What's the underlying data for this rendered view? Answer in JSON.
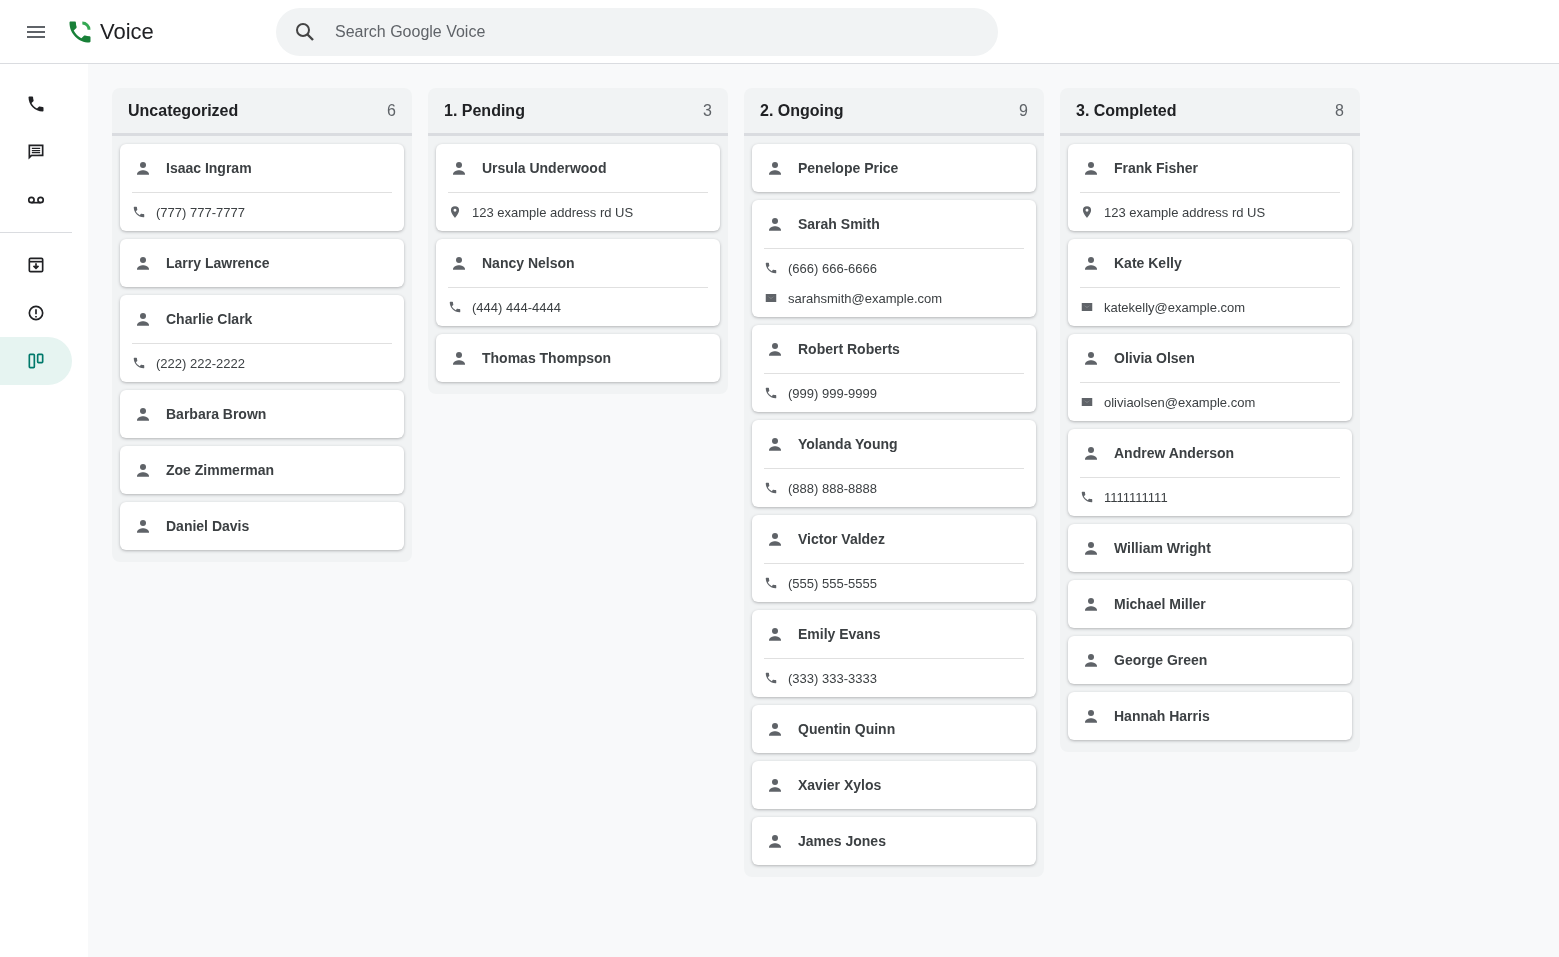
{
  "app": {
    "title": "Voice"
  },
  "search": {
    "placeholder": "Search Google Voice"
  },
  "nav": [
    {
      "kind": "calls",
      "selected": false
    },
    {
      "kind": "messages",
      "selected": false
    },
    {
      "kind": "voicemail",
      "selected": false
    },
    {
      "kind": "archive",
      "selected": false
    },
    {
      "kind": "spam",
      "selected": false
    },
    {
      "kind": "board",
      "selected": true
    }
  ],
  "columns": [
    {
      "title": "Uncategorized",
      "count": "6",
      "cards": [
        {
          "name": "Isaac Ingram",
          "details": [
            {
              "kind": "phone",
              "text": "(777) 777-7777"
            }
          ]
        },
        {
          "name": "Larry Lawrence"
        },
        {
          "name": "Charlie Clark",
          "details": [
            {
              "kind": "phone",
              "text": "(222) 222-2222"
            }
          ]
        },
        {
          "name": "Barbara Brown"
        },
        {
          "name": "Zoe Zimmerman"
        },
        {
          "name": "Daniel Davis"
        }
      ]
    },
    {
      "title": "1. Pending",
      "count": "3",
      "cards": [
        {
          "name": "Ursula Underwood",
          "details": [
            {
              "kind": "address",
              "text": "123 example address rd US"
            }
          ]
        },
        {
          "name": "Nancy Nelson",
          "details": [
            {
              "kind": "phone",
              "text": "(444) 444-4444"
            }
          ]
        },
        {
          "name": "Thomas Thompson"
        }
      ]
    },
    {
      "title": "2. Ongoing",
      "count": "9",
      "cards": [
        {
          "name": "Penelope Price"
        },
        {
          "name": "Sarah Smith",
          "details": [
            {
              "kind": "phone",
              "text": "(666) 666-6666"
            },
            {
              "kind": "email",
              "text": "sarahsmith@example.com"
            }
          ]
        },
        {
          "name": "Robert Roberts",
          "details": [
            {
              "kind": "phone",
              "text": "(999) 999-9999"
            }
          ]
        },
        {
          "name": "Yolanda Young",
          "details": [
            {
              "kind": "phone",
              "text": "(888) 888-8888"
            }
          ]
        },
        {
          "name": "Victor Valdez",
          "details": [
            {
              "kind": "phone",
              "text": "(555) 555-5555"
            }
          ]
        },
        {
          "name": "Emily Evans",
          "details": [
            {
              "kind": "phone",
              "text": "(333) 333-3333"
            }
          ]
        },
        {
          "name": "Quentin Quinn"
        },
        {
          "name": "Xavier Xylos"
        },
        {
          "name": "James Jones"
        }
      ]
    },
    {
      "title": "3. Completed",
      "count": "8",
      "cards": [
        {
          "name": "Frank Fisher",
          "details": [
            {
              "kind": "address",
              "text": "123 example address rd US"
            }
          ]
        },
        {
          "name": "Kate Kelly",
          "details": [
            {
              "kind": "email",
              "text": "katekelly@example.com"
            }
          ]
        },
        {
          "name": "Olivia Olsen",
          "details": [
            {
              "kind": "email",
              "text": "oliviaolsen@example.com"
            }
          ]
        },
        {
          "name": "Andrew Anderson",
          "details": [
            {
              "kind": "phone",
              "text": "1111111111"
            }
          ]
        },
        {
          "name": "William Wright"
        },
        {
          "name": "Michael Miller"
        },
        {
          "name": "George Green"
        },
        {
          "name": "Hannah Harris"
        }
      ]
    }
  ]
}
